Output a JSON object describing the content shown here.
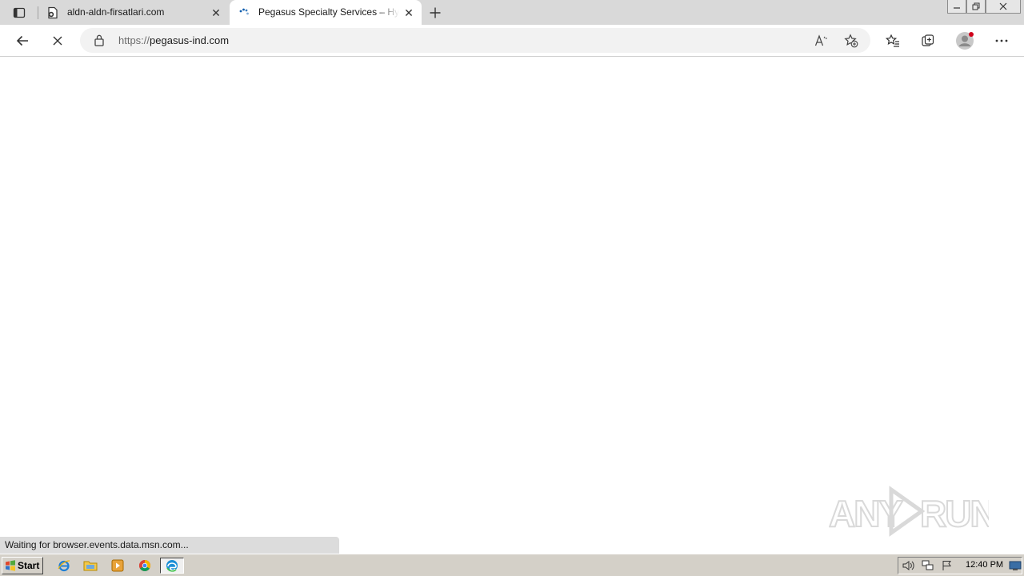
{
  "browser": {
    "tabs": [
      {
        "title": "aldn-aldn-firsatlari.com",
        "favicon": "page-icon",
        "active": false
      },
      {
        "title": "Pegasus Specialty Services – Hydr",
        "favicon": "loading-spinner-icon",
        "active": true
      }
    ],
    "new_tab_icon": "plus-icon",
    "address": {
      "protocol": "https://",
      "host": "pegasus-ind.com"
    },
    "status_text": "Waiting for browser.events.data.msn.com..."
  },
  "watermark": {
    "text": "ANY RUN"
  },
  "taskbar": {
    "start_label": "Start",
    "quick_launch": [
      "internet-explorer-icon",
      "folder-icon",
      "media-player-icon",
      "chrome-icon",
      "edge-icon"
    ],
    "clock": "12:40 PM"
  },
  "colors": {
    "tabbar": "#d9d9d9",
    "omnibox": "#f2f2f2",
    "taskbar": "#d4d0c8",
    "spinner": "#0b5cad"
  }
}
